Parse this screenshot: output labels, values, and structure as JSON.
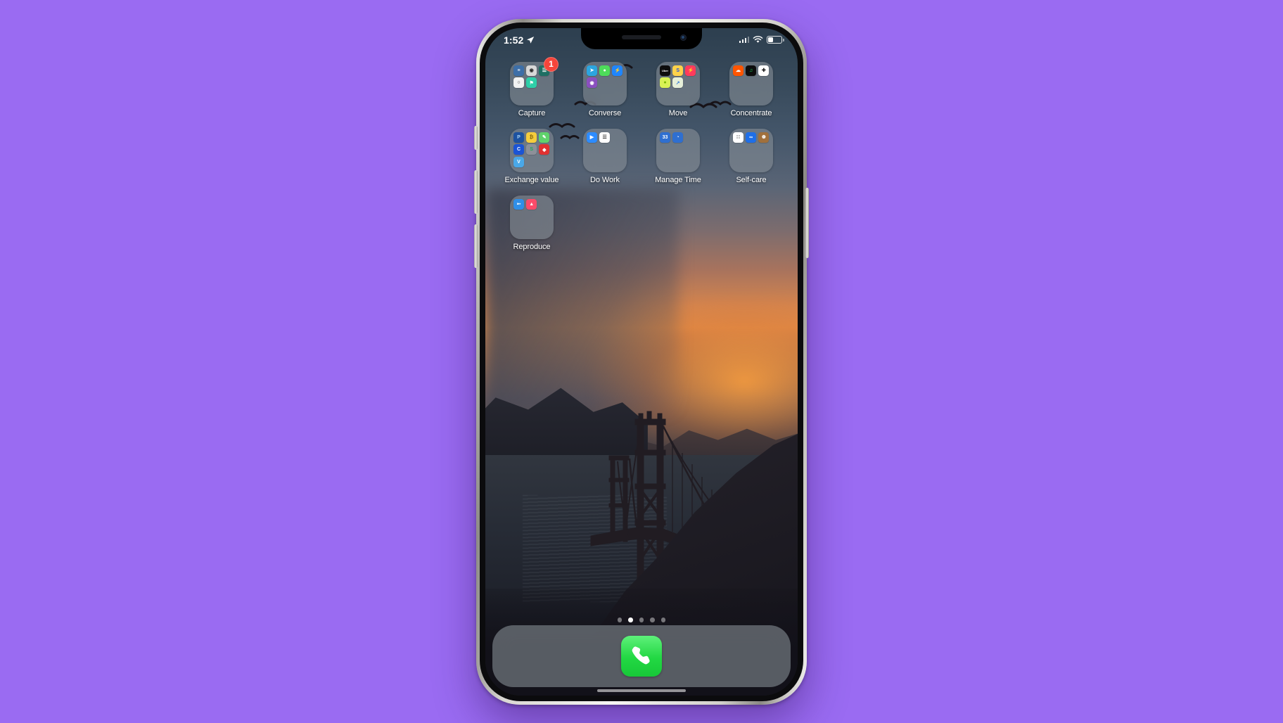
{
  "device": {
    "name": "iPhone X",
    "frame_color": "#d9d7d2",
    "background_color": "#9a6bf2"
  },
  "status_bar": {
    "time": "1:52",
    "location_icon": "location-arrow-icon",
    "cellular_icon": "cellular-signal-icon",
    "cellular_bars_filled": 3,
    "cellular_bars_total": 4,
    "wifi_icon": "wifi-icon",
    "battery_icon": "battery-icon",
    "battery_percent": 35
  },
  "wallpaper": {
    "name": "golden-gate-bridge-sunset",
    "sky_color": "#e08c4a",
    "water_color": "#272c36"
  },
  "home_screen": {
    "rows": [
      [
        {
          "label": "Capture",
          "type": "folder",
          "badge": "1",
          "badge_color": "#f5453b",
          "apps": [
            {
              "name": "reminders-app",
              "glyph": "≡",
              "bg": "#3d6fa8",
              "fg": "#ffffff"
            },
            {
              "name": "camera-app",
              "glyph": "◉",
              "bg": "#d8d8d8",
              "fg": "#2b2b2b"
            },
            {
              "name": "scanner-app",
              "glyph": "☰",
              "bg": "#1f6f63",
              "fg": "#ffffff"
            },
            {
              "name": "halide-camera-app",
              "glyph": "○",
              "bg": "#f2f2f2",
              "fg": "#1a1a1a"
            },
            {
              "name": "bookmark-app",
              "glyph": "⚑",
              "bg": "#2ecfa8",
              "fg": "#ffffff"
            }
          ]
        },
        {
          "label": "Converse",
          "type": "folder",
          "badge": "",
          "apps": [
            {
              "name": "telegram-app",
              "glyph": "➤",
              "bg": "#2ca5e0",
              "fg": "#ffffff"
            },
            {
              "name": "messages-app",
              "glyph": "●",
              "bg": "#4ddc5a",
              "fg": "#ffffff"
            },
            {
              "name": "messenger-app",
              "glyph": "⚡",
              "bg": "#1f86fe",
              "fg": "#ffffff"
            },
            {
              "name": "viber-app",
              "glyph": "◉",
              "bg": "#8a4fbf",
              "fg": "#ffffff"
            }
          ]
        },
        {
          "label": "Move",
          "type": "folder",
          "badge": "",
          "apps": [
            {
              "name": "uber-app",
              "glyph": "Uber",
              "bg": "#0d0d0d",
              "fg": "#ffffff"
            },
            {
              "name": "scooter-app",
              "glyph": "S",
              "bg": "#ffd24a",
              "fg": "#1f4fd8"
            },
            {
              "name": "lyft-app",
              "glyph": "⚡",
              "bg": "#ff3b5c",
              "fg": "#ffffff"
            },
            {
              "name": "lime-app",
              "glyph": "●",
              "bg": "#d9f255",
              "fg": "#7ab800"
            },
            {
              "name": "maps-app",
              "glyph": "↗",
              "bg": "#e6efd9",
              "fg": "#3a7fd5"
            }
          ]
        },
        {
          "label": "Concentrate",
          "type": "folder",
          "badge": "",
          "apps": [
            {
              "name": "soundcloud-app",
              "glyph": "☁",
              "bg": "#ff5500",
              "fg": "#ffffff"
            },
            {
              "name": "spotify-app",
              "glyph": "♫",
              "bg": "#0d0d0d",
              "fg": "#1ed760"
            },
            {
              "name": "noisli-app",
              "glyph": "✚",
              "bg": "#ffffff",
              "fg": "#1a1a1a"
            }
          ]
        }
      ],
      [
        {
          "label": "Exchange value",
          "type": "folder",
          "badge": "",
          "apps": [
            {
              "name": "paypal-app",
              "glyph": "P",
              "bg": "#1d52a0",
              "fg": "#a9d5f5"
            },
            {
              "name": "bitcoin-wallet-app",
              "glyph": "₿",
              "bg": "#f5cc3d",
              "fg": "#8a6a0a"
            },
            {
              "name": "notes-app",
              "glyph": "✎",
              "bg": "#5fd36c",
              "fg": "#ffffff"
            },
            {
              "name": "coinbase-app",
              "glyph": "C",
              "bg": "#1a54d6",
              "fg": "#ffffff"
            },
            {
              "name": "stocks-app",
              "glyph": "S",
              "bg": "#8d9099",
              "fg": "#1aa85a"
            },
            {
              "name": "robinhood-app",
              "glyph": "◆",
              "bg": "#e03131",
              "fg": "#ffffff"
            },
            {
              "name": "venmo-app",
              "glyph": "V",
              "bg": "#4aa8e8",
              "fg": "#ffffff"
            }
          ]
        },
        {
          "label": "Do Work",
          "type": "folder",
          "badge": "",
          "apps": [
            {
              "name": "zoom-app",
              "glyph": "▶",
              "bg": "#2d8cff",
              "fg": "#ffffff"
            },
            {
              "name": "doordash-app",
              "glyph": "☰",
              "bg": "#ffffff",
              "fg": "#444444"
            }
          ]
        },
        {
          "label": "Manage Time",
          "type": "folder",
          "badge": "",
          "apps": [
            {
              "name": "calendar-app",
              "glyph": "33",
              "bg": "#2f6fd0",
              "fg": "#ffffff"
            },
            {
              "name": "clock-app",
              "glyph": "◔",
              "bg": "#2f6fd0",
              "fg": "#ffffff"
            }
          ]
        },
        {
          "label": "Self-care",
          "type": "folder",
          "badge": "",
          "apps": [
            {
              "name": "habit-tracker-app",
              "glyph": "∷",
              "bg": "#ffffff",
              "fg": "#333333"
            },
            {
              "name": "streaks-app",
              "glyph": "∞",
              "bg": "#1f6fe8",
              "fg": "#ffffff"
            },
            {
              "name": "meditation-app",
              "glyph": "☸",
              "bg": "#a0703c",
              "fg": "#ffffff"
            }
          ]
        }
      ],
      [
        {
          "label": "Reproduce",
          "type": "folder",
          "badge": "",
          "apps": [
            {
              "name": "safari-app",
              "glyph": "➳",
              "bg": "#2f8fe8",
              "fg": "#ffffff"
            },
            {
              "name": "tinder-app",
              "glyph": "▲",
              "bg": "#fd4b6a",
              "fg": "#ffffff"
            }
          ]
        }
      ]
    ]
  },
  "page_dots": {
    "total": 5,
    "active_index": 1
  },
  "dock": {
    "apps": [
      {
        "name": "phone-app",
        "label": "Phone",
        "color": "#22d843",
        "icon": "phone-handset-icon"
      }
    ]
  }
}
